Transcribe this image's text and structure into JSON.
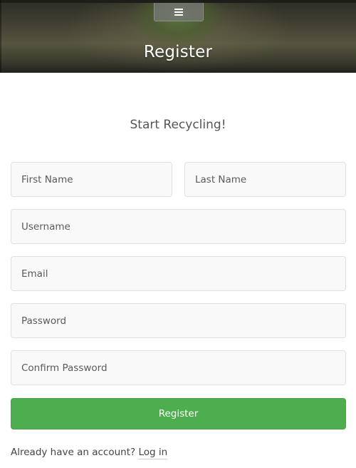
{
  "header": {
    "title": "Register",
    "menu_icon": "hamburger-icon"
  },
  "form": {
    "subtitle": "Start Recycling!",
    "first_name_placeholder": "First Name",
    "last_name_placeholder": "Last Name",
    "username_placeholder": "Username",
    "email_placeholder": "Email",
    "password_placeholder": "Password",
    "confirm_password_placeholder": "Confirm Password",
    "submit_label": "Register"
  },
  "footer": {
    "prompt": "Already have an account? ",
    "login_link": "Log in"
  },
  "colors": {
    "accent_green": "#4cae4c",
    "field_background": "#f9f9f9",
    "field_border": "#e0e0e0"
  }
}
